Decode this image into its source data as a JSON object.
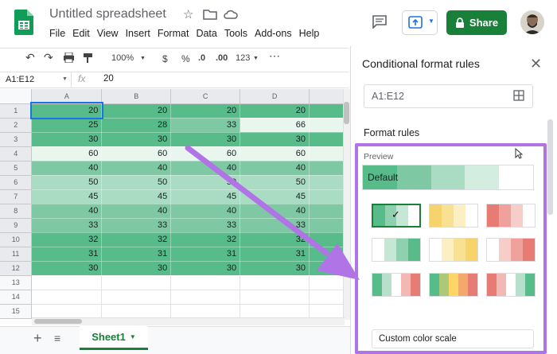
{
  "app": {
    "doc_title": "Untitled spreadsheet",
    "menu": [
      "File",
      "Edit",
      "View",
      "Insert",
      "Format",
      "Data",
      "Tools",
      "Add-ons",
      "Help"
    ],
    "share_label": "Share"
  },
  "toolbar": {
    "zoom": "100%",
    "currency": "$",
    "percent": "%",
    "dec_less": ".0",
    "dec_more": ".00",
    "format_more": "123"
  },
  "formula": {
    "cell_ref": "A1:E12",
    "fx": "fx",
    "value": "20"
  },
  "grid": {
    "columns": [
      "A",
      "B",
      "C",
      "D"
    ],
    "rows": [
      {
        "n": "1",
        "v": [
          "20",
          "20",
          "20",
          "20"
        ]
      },
      {
        "n": "2",
        "v": [
          "25",
          "28",
          "33",
          "66"
        ]
      },
      {
        "n": "3",
        "v": [
          "30",
          "30",
          "30",
          "30"
        ]
      },
      {
        "n": "4",
        "v": [
          "60",
          "60",
          "60",
          "60"
        ]
      },
      {
        "n": "5",
        "v": [
          "40",
          "40",
          "40",
          "40"
        ]
      },
      {
        "n": "6",
        "v": [
          "50",
          "50",
          "50",
          "50"
        ]
      },
      {
        "n": "7",
        "v": [
          "45",
          "45",
          "45",
          "45"
        ]
      },
      {
        "n": "8",
        "v": [
          "40",
          "40",
          "40",
          "40"
        ]
      },
      {
        "n": "9",
        "v": [
          "33",
          "33",
          "33",
          "33"
        ]
      },
      {
        "n": "10",
        "v": [
          "32",
          "32",
          "32",
          "32"
        ]
      },
      {
        "n": "11",
        "v": [
          "31",
          "31",
          "31",
          "31"
        ]
      },
      {
        "n": "12",
        "v": [
          "30",
          "30",
          "30",
          "30"
        ]
      }
    ],
    "empty_rows": [
      "13",
      "14",
      "15"
    ],
    "colors": {
      "dark": "#57bb8a",
      "mid": "#7ec9a3",
      "light": "#a9dcc2",
      "pale": "#e8f6ee"
    }
  },
  "sheet": {
    "tab_label": "Sheet1",
    "add_icon": "plus-icon",
    "list_icon": "list-icon"
  },
  "panel": {
    "title": "Conditional format rules",
    "range": "A1:E12",
    "format_rules_label": "Format rules",
    "preview_label": "Preview",
    "preview_default": "Default",
    "custom_scale": "Custom color scale",
    "checkmark": "✓"
  },
  "accent": {
    "green": "#188038",
    "highlight": "#b174e6"
  }
}
